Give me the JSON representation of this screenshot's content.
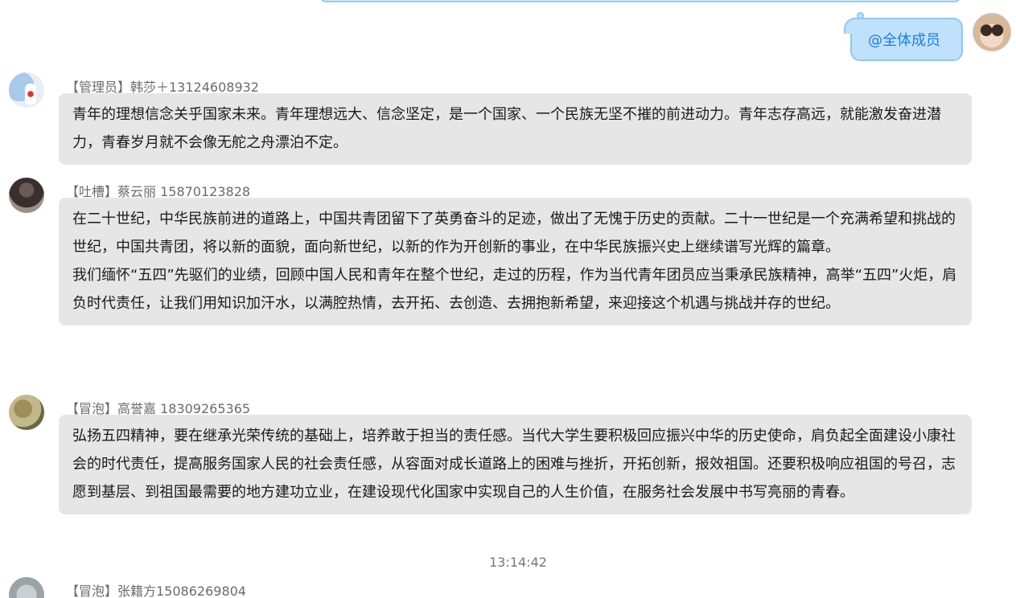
{
  "outgoing": {
    "text": "@全体成员"
  },
  "messages": [
    {
      "sender": "【管理员】韩莎＋13124608932",
      "paragraphs": [
        "青年的理想信念关乎国家未来。青年理想远大、信念坚定，是一个国家、一个民族无坚不摧的前进动力。青年志存高远，就能激发奋进潜力，青春岁月就不会像无舵之舟漂泊不定。"
      ]
    },
    {
      "sender": "【吐槽】蔡云丽 15870123828",
      "paragraphs": [
        "在二十世纪，中华民族前进的道路上，中国共青团留下了英勇奋斗的足迹，做出了无愧于历史的贡献。二十一世纪是一个充满希望和挑战的世纪，中国共青团，将以新的面貌，面向新世纪，以新的作为开创新的事业，在中华民族振兴史上继续谱写光辉的篇章。",
        "我们缅怀“五四”先驱们的业绩，回顾中国人民和青年在整个世纪，走过的历程，作为当代青年团员应当秉承民族精神，高举“五四”火炬，肩负时代责任，让我们用知识加汗水，以满腔热情，去开拓、去创造、去拥抱新希望，来迎接这个机遇与挑战并存的世纪。"
      ]
    },
    {
      "sender": "【冒泡】高誉嘉  18309265365",
      "paragraphs": [
        "弘扬五四精神，要在继承光荣传统的基础上，培养敢于担当的责任感。当代大学生要积极回应振兴中华的历史使命，肩负起全面建设小康社会的时代责任，提高服务国家人民的社会责任感，从容面对成长道路上的困难与挫折，开拓创新，报效祖国。还要积极响应祖国的号召，志愿到基层、到祖国最需要的地方建功立业，在建设现代化国家中实现自己的人生价值，在服务社会发展中书写亮丽的青春。"
      ]
    }
  ],
  "timestamp": "13:14:42",
  "next_message": {
    "sender": "【冒泡】张籍方15086269804"
  }
}
